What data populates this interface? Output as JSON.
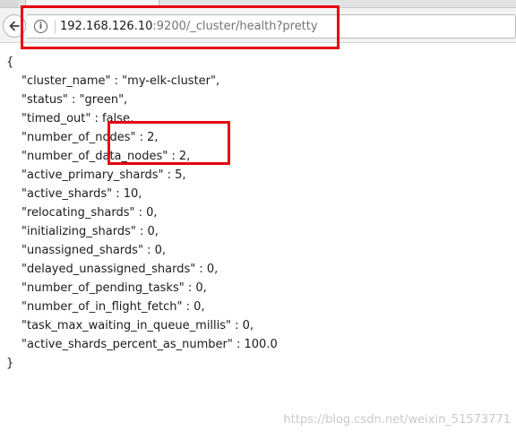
{
  "browser": {
    "url_host": "192.168.126.10",
    "url_rest": ":9200/_cluster/health?pretty",
    "info_glyph": "i"
  },
  "json_open": "{",
  "json_close": "}",
  "json_lines": [
    "\"cluster_name\" : \"my-elk-cluster\",",
    "\"status\" : \"green\",",
    "\"timed_out\" : false,",
    "\"number_of_nodes\" : 2,",
    "\"number_of_data_nodes\" : 2,",
    "\"active_primary_shards\" : 5,",
    "\"active_shards\" : 10,",
    "\"relocating_shards\" : 0,",
    "\"initializing_shards\" : 0,",
    "\"unassigned_shards\" : 0,",
    "\"delayed_unassigned_shards\" : 0,",
    "\"number_of_pending_tasks\" : 0,",
    "\"number_of_in_flight_fetch\" : 0,",
    "\"task_max_waiting_in_queue_millis\" : 0,",
    "\"active_shards_percent_as_number\" : 100.0"
  ],
  "watermark": "https://blog.csdn.net/weixin_51573771",
  "colors": {
    "annotation": "#e60012",
    "text": "#1c1c1c",
    "url_muted": "#737373"
  },
  "icons": [
    "back-arrow-icon",
    "info-icon"
  ]
}
